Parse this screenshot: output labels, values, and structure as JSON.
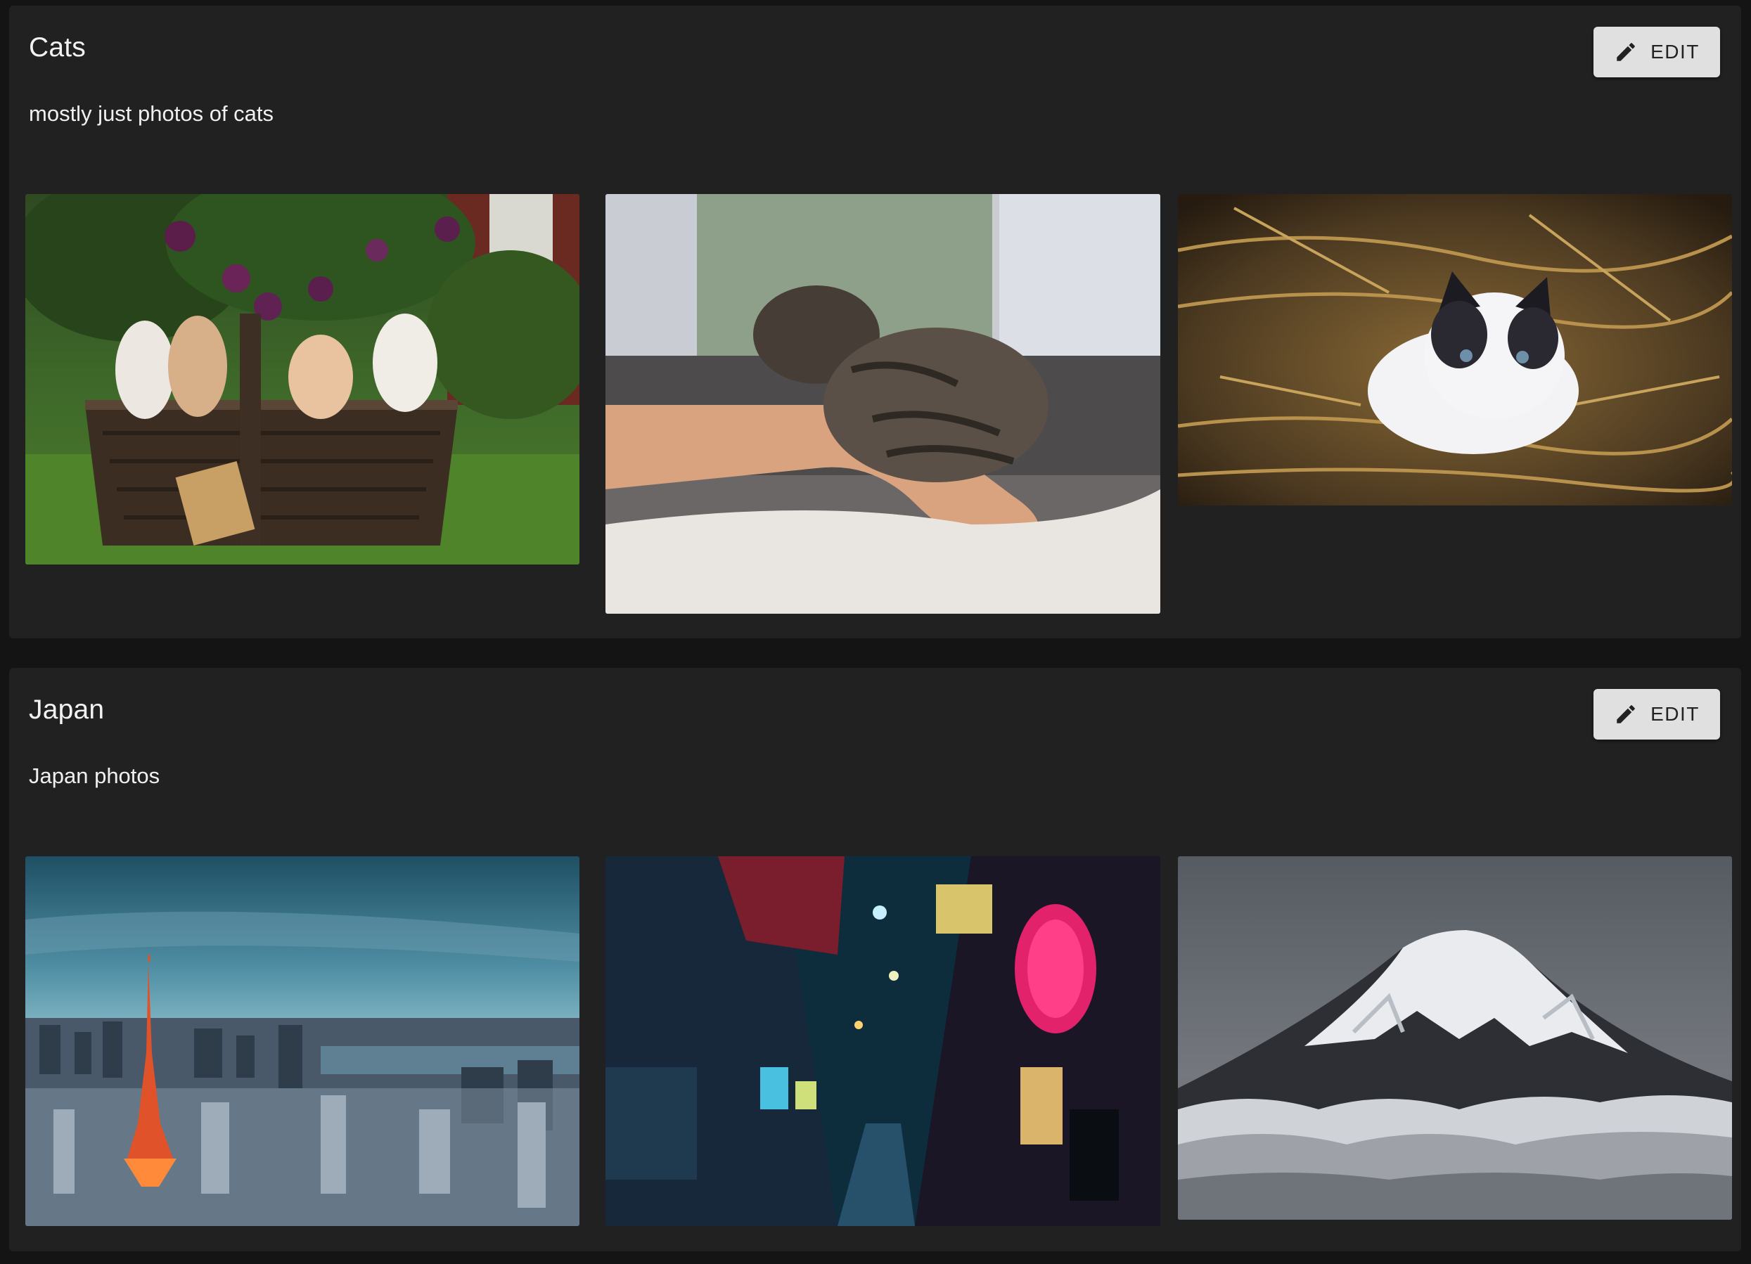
{
  "albums": [
    {
      "title": "Cats",
      "description": "mostly just photos of cats",
      "edit_label": "EDIT",
      "edit_icon": "pencil-icon",
      "photos": [
        {
          "subject": "kittens in a basket"
        },
        {
          "subject": "kitten on an arm"
        },
        {
          "subject": "kitten in straw"
        }
      ]
    },
    {
      "title": "Japan",
      "description": "Japan photos",
      "edit_label": "EDIT",
      "edit_icon": "pencil-icon",
      "photos": [
        {
          "subject": "Tokyo skyline with tower"
        },
        {
          "subject": "neon alley at night"
        },
        {
          "subject": "Mount Fuji above clouds"
        }
      ]
    }
  ],
  "colors": {
    "page_background": "#141414",
    "card_background": "#212121",
    "button_background": "#e0e0e0",
    "title_text": "#f2f2f2"
  }
}
